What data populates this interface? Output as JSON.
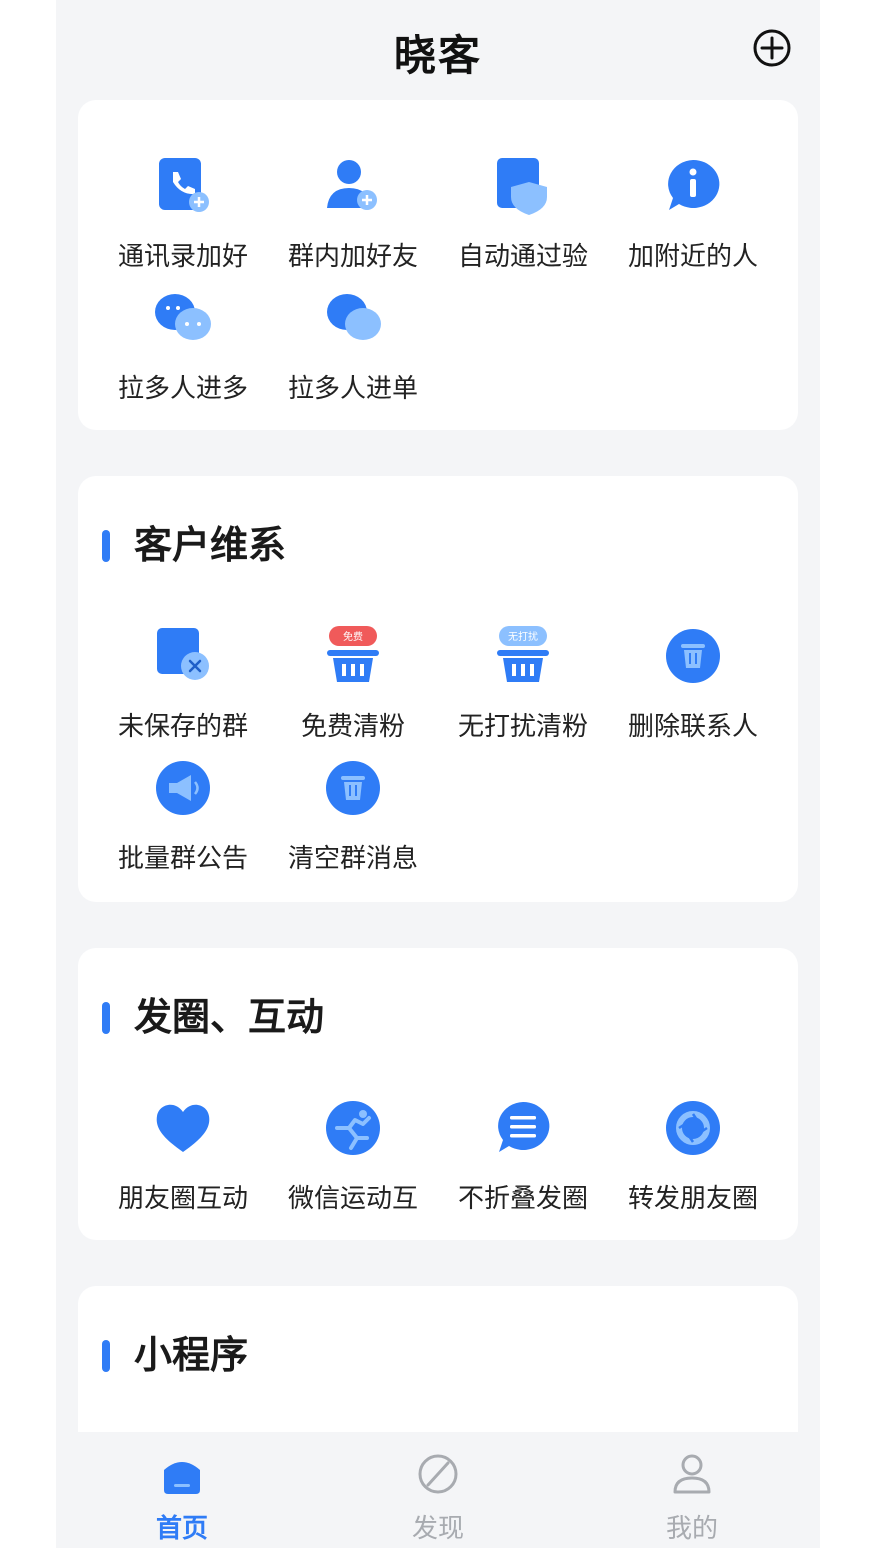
{
  "app": {
    "title": "晓客"
  },
  "sections": [
    {
      "title": "",
      "items": [
        {
          "label": "通讯录加好",
          "icon": "contact-book-icon"
        },
        {
          "label": "群内加好友",
          "icon": "add-user-icon"
        },
        {
          "label": "自动通过验",
          "icon": "shield-icon"
        },
        {
          "label": "加附近的人",
          "icon": "info-bubble-icon"
        },
        {
          "label": "拉多人进多",
          "icon": "group-chat-icon"
        },
        {
          "label": "拉多人进单",
          "icon": "chat-bubbles-icon"
        }
      ]
    },
    {
      "title": "客户维系",
      "items": [
        {
          "label": "未保存的群",
          "icon": "unsaved-group-icon"
        },
        {
          "label": "免费清粉",
          "icon": "basket-icon",
          "badge": "免费"
        },
        {
          "label": "无打扰清粉",
          "icon": "basket-icon",
          "badge": "无打扰"
        },
        {
          "label": "删除联系人",
          "icon": "trash-icon"
        },
        {
          "label": "批量群公告",
          "icon": "megaphone-icon"
        },
        {
          "label": "清空群消息",
          "icon": "trash-icon"
        }
      ]
    },
    {
      "title": "发圈、互动",
      "items": [
        {
          "label": "朋友圈互动",
          "icon": "heart-icon"
        },
        {
          "label": "微信运动互",
          "icon": "running-icon"
        },
        {
          "label": "不折叠发圈",
          "icon": "list-bubble-icon"
        },
        {
          "label": "转发朋友圈",
          "icon": "aperture-icon"
        }
      ]
    },
    {
      "title": "小程序",
      "items": []
    }
  ],
  "tabs": [
    {
      "label": "首页",
      "icon": "home-icon",
      "active": true
    },
    {
      "label": "发现",
      "icon": "compass-icon",
      "active": false
    },
    {
      "label": "我的",
      "icon": "profile-icon",
      "active": false
    }
  ],
  "colors": {
    "accent": "#2f7cf6",
    "light": "#8cc0ff",
    "red": "#f05a5a",
    "background": "#f4f5f7"
  }
}
